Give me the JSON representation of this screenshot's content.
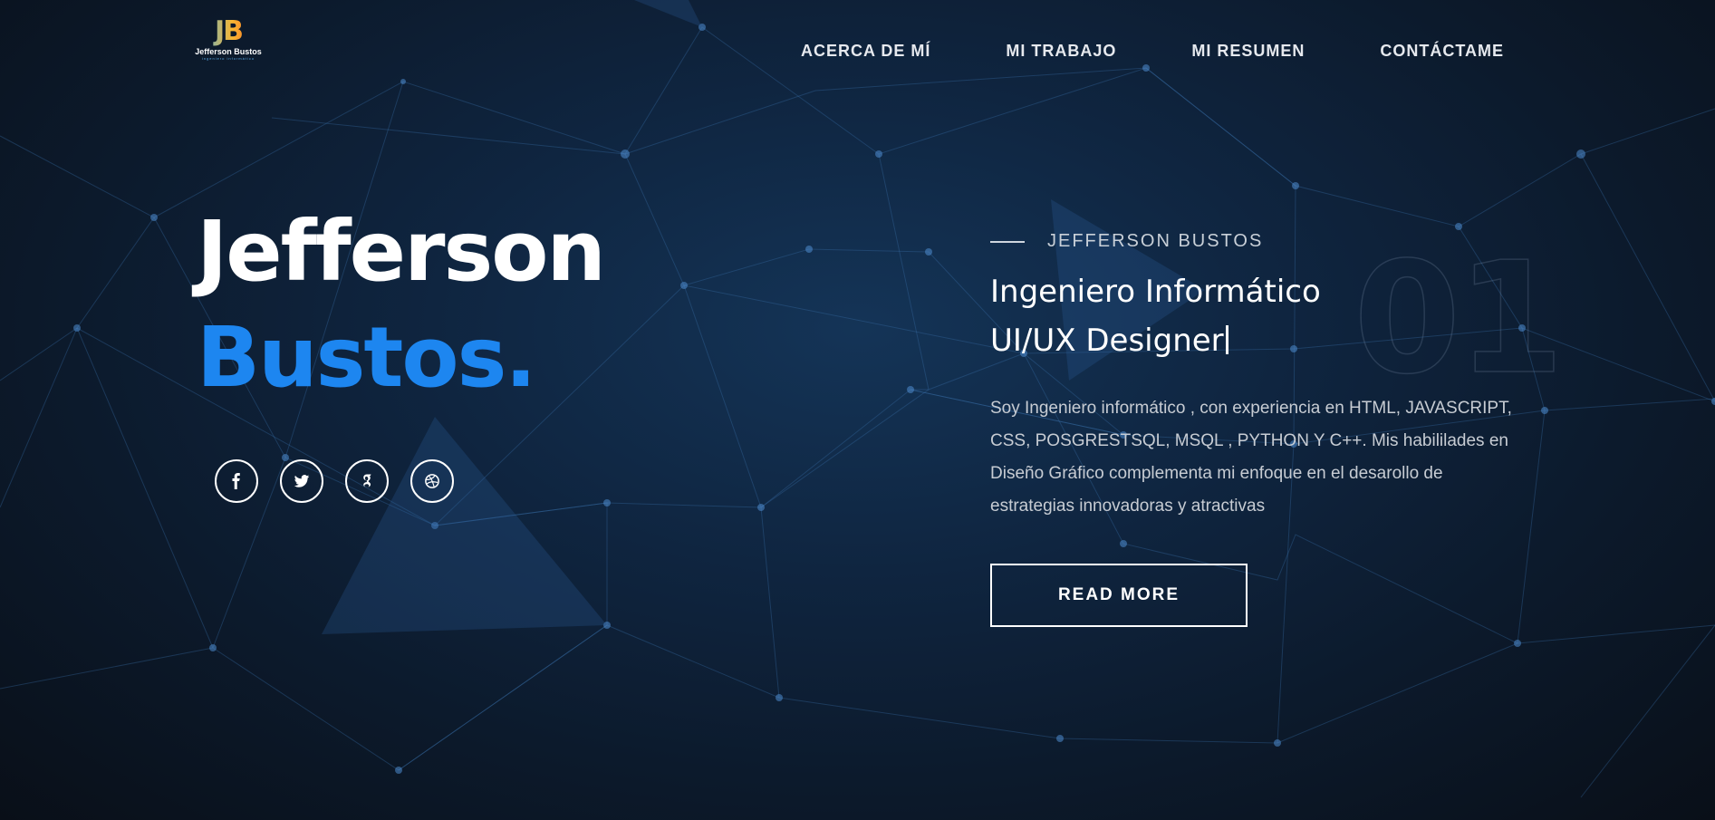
{
  "brand": {
    "monogram": "JB",
    "name": "Jefferson Bustos",
    "tagline": "ingeniero informático",
    "gradient_colors": [
      "#2fb0ff",
      "#f7b733",
      "#fc4a1a"
    ]
  },
  "nav": {
    "items": [
      {
        "label": "ACERCA DE MÍ"
      },
      {
        "label": "MI TRABAJO"
      },
      {
        "label": "MI RESUMEN"
      },
      {
        "label": "CONTÁCTAME"
      }
    ]
  },
  "hero": {
    "first_name": "Jefferson",
    "last_name": "Bustos.",
    "accent_color": "#1d86f0"
  },
  "social": {
    "icons": [
      "facebook-icon",
      "twitter-icon",
      "google-icon",
      "dribbble-icon"
    ]
  },
  "intro": {
    "eyebrow": "JEFFERSON BUSTOS",
    "number": "01",
    "role_line1": "Ingeniero Informático",
    "role_line2": "UI/UX Designer",
    "bio": "Soy Ingeniero informático , con experiencia en HTML, JAVASCRIPT, CSS, POSGRESTSQL, MSQL , PYTHON Y C++. Mis habililades en Diseño Gráfico complementa mi enfoque en el desarollo de estrategias innovadoras y atractivas",
    "button_label": "READ MORE"
  }
}
